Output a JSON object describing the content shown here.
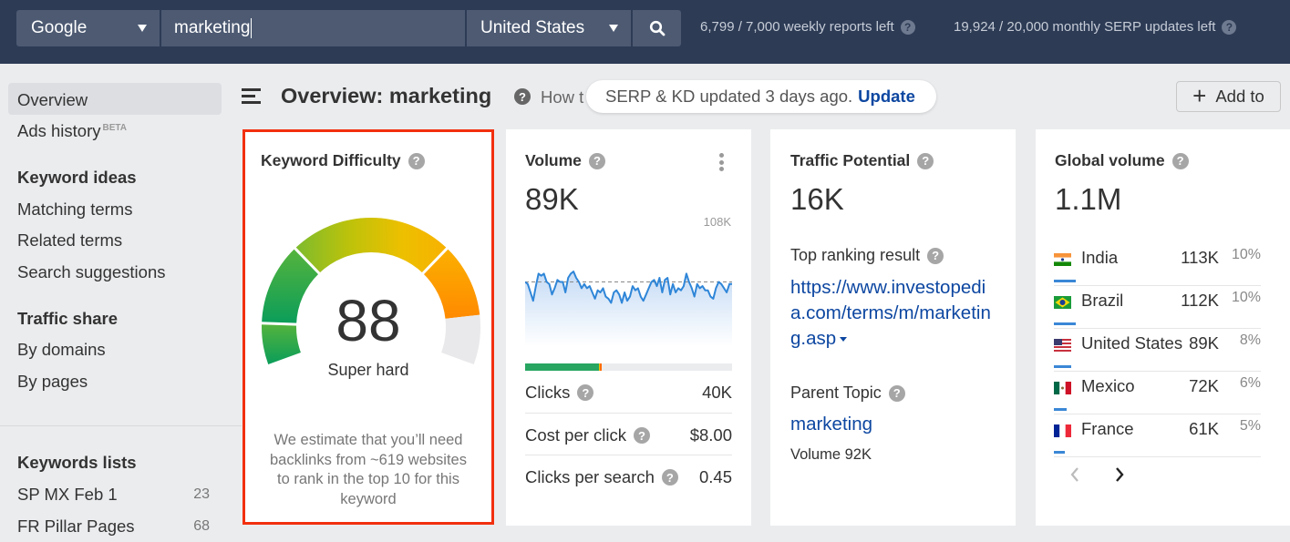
{
  "topbar": {
    "engine": "Google",
    "query": "marketing",
    "country": "United States",
    "search_icon": "search-icon",
    "quota_weekly": "6,799 / 7,000 weekly reports left",
    "quota_monthly": "19,924 / 20,000 monthly SERP updates left"
  },
  "sidebar": {
    "overview": "Overview",
    "ads_history": "Ads history",
    "beta": "BETA",
    "keyword_ideas_heading": "Keyword ideas",
    "matching_terms": "Matching terms",
    "related_terms": "Related terms",
    "search_suggestions": "Search suggestions",
    "traffic_share_heading": "Traffic share",
    "by_domains": "By domains",
    "by_pages": "By pages",
    "keywords_lists_heading": "Keywords lists",
    "lists": [
      {
        "name": "SP MX Feb 1",
        "count": "23"
      },
      {
        "name": "FR Pillar Pages",
        "count": "68"
      }
    ]
  },
  "header": {
    "title": "Overview: marketing",
    "howto": "How t",
    "update_notice": "SERP & KD updated 3 days ago.",
    "update_link": "Update",
    "add_to": "Add to",
    "help_glyph": "?"
  },
  "kd": {
    "title": "Keyword Difficulty",
    "value": "88",
    "score": 88,
    "label": "Super hard",
    "note": "We estimate that you’ll need backlinks from ~619 websites to rank in the top 10 for this keyword",
    "colors": {
      "accent_border": "#f2300f"
    }
  },
  "volume": {
    "title": "Volume",
    "value": "89K",
    "max_label": "108K",
    "clicks_split": {
      "organic_pct": 35.5,
      "paid_yellow_pct": 0.8,
      "paid_orange_pct": 0.8
    },
    "metrics": [
      {
        "label": "Clicks",
        "value": "40K"
      },
      {
        "label": "Cost per click",
        "value": "$8.00"
      },
      {
        "label": "Clicks per search",
        "value": "0.45"
      }
    ],
    "chart_data": {
      "type": "line",
      "title": "",
      "ymax_label": "108K",
      "ylim": [
        0,
        108
      ],
      "average": 89,
      "values": [
        89,
        88,
        84,
        80,
        87,
        93,
        92,
        93,
        89,
        88,
        83,
        86,
        90,
        89,
        89,
        84,
        91,
        93,
        94,
        91,
        89,
        86,
        88,
        86,
        87,
        84,
        81,
        85,
        84,
        86,
        82,
        81,
        79,
        84,
        85,
        83,
        79,
        84,
        80,
        82,
        87,
        85,
        86,
        82,
        80,
        83,
        86,
        89,
        90,
        87,
        91,
        84,
        90,
        91,
        83,
        88,
        84,
        86,
        85,
        87,
        93,
        89,
        86,
        82,
        88,
        86,
        87,
        85,
        85,
        82,
        81,
        86,
        89,
        88,
        86,
        84,
        88,
        88
      ]
    }
  },
  "traffic_potential": {
    "title": "Traffic Potential",
    "value": "16K",
    "top_result_label": "Top ranking result",
    "top_result_url": "https://www.investopedia.com/terms/m/marketing.asp",
    "parent_topic_label": "Parent Topic",
    "parent_topic": "marketing",
    "parent_volume": "Volume 92K"
  },
  "global_volume": {
    "title": "Global volume",
    "value": "1.1M",
    "countries": [
      {
        "name": "India",
        "volume": "113K",
        "pct": "10%",
        "share": 10
      },
      {
        "name": "Brazil",
        "volume": "112K",
        "pct": "10%",
        "share": 10
      },
      {
        "name": "United States",
        "volume": "89K",
        "pct": "8%",
        "share": 8
      },
      {
        "name": "Mexico",
        "volume": "72K",
        "pct": "6%",
        "share": 6
      },
      {
        "name": "France",
        "volume": "61K",
        "pct": "5%",
        "share": 5
      }
    ],
    "prev": "‹",
    "next": "›"
  }
}
